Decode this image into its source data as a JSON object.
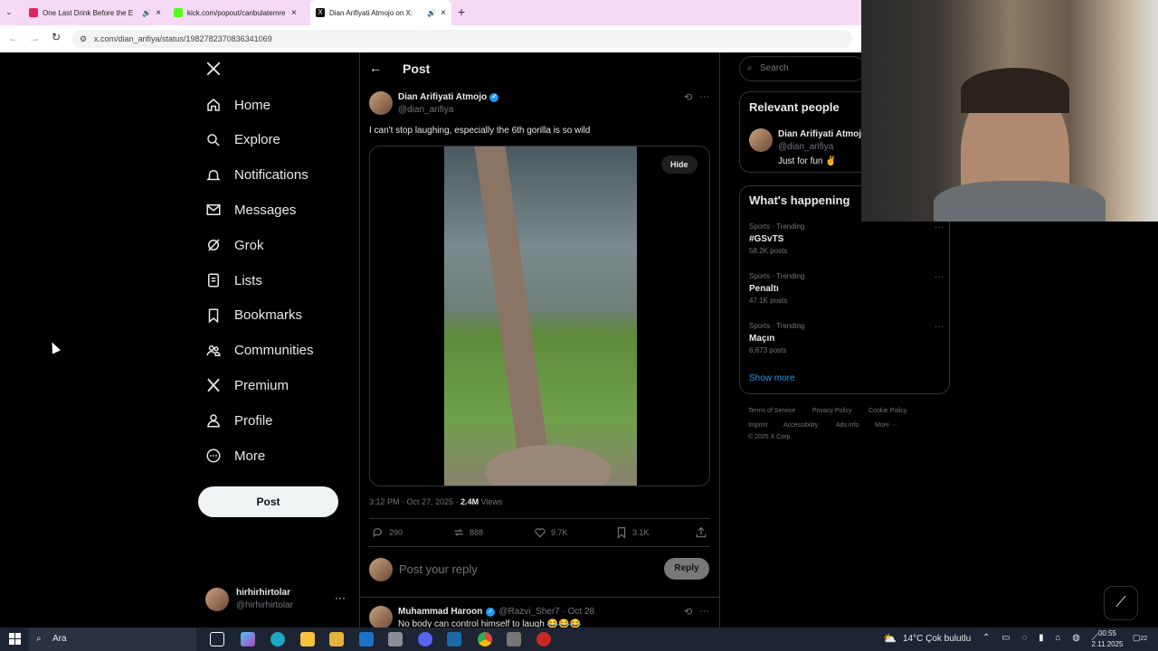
{
  "browser": {
    "tabs": [
      {
        "title": "One Last Drink Before the E",
        "color": "#e0245e"
      },
      {
        "title": "kick.com/popout/canbulatemre",
        "color": "#53fc18"
      },
      {
        "title": "Dian Arifiyati Atmojo on X:",
        "color": "#000000"
      }
    ],
    "url": "x.com/dian_arifiya/status/1982782370836341069"
  },
  "nav": {
    "items": [
      {
        "label": "Home",
        "icon": "home-icon"
      },
      {
        "label": "Explore",
        "icon": "search-icon"
      },
      {
        "label": "Notifications",
        "icon": "bell-icon"
      },
      {
        "label": "Messages",
        "icon": "mail-icon"
      },
      {
        "label": "Grok",
        "icon": "grok-icon"
      },
      {
        "label": "Lists",
        "icon": "list-icon"
      },
      {
        "label": "Bookmarks",
        "icon": "bookmark-icon"
      },
      {
        "label": "Communities",
        "icon": "communities-icon"
      },
      {
        "label": "Premium",
        "icon": "x-logo-icon"
      },
      {
        "label": "Profile",
        "icon": "person-icon"
      },
      {
        "label": "More",
        "icon": "more-circle-icon"
      }
    ],
    "post_button": "Post",
    "account": {
      "name": "hirhirhirtolar",
      "handle": "@hirhirhirtolar"
    }
  },
  "post": {
    "header": "Post",
    "author_name": "Dian Arifiyati Atmojo",
    "author_handle": "@dian_arifiya",
    "text": "I can't stop laughing, especially the 6th gorilla is so wild",
    "hide_label": "Hide",
    "time": "3:12 PM · Oct 27, 2025 · ",
    "views_count": "2.4M",
    "views_label": "Views",
    "stats": {
      "replies": "290",
      "reposts": "888",
      "likes": "9.7K",
      "bookmarks": "3.1K"
    },
    "reply_placeholder": "Post your reply",
    "reply_button": "Reply"
  },
  "reply": {
    "name": "Muhammad Haroon",
    "handle": "@Razvi_Sher7 · Oct 28",
    "text": "No body can control himself to laugh 😂😂😂"
  },
  "sidebar": {
    "search_placeholder": "Search",
    "relevant_title": "Relevant people",
    "relevant_name": "Dian Arifiyati Atmoj",
    "relevant_handle": "@dian_arifiya",
    "relevant_bio": "Just for fun ✌️",
    "happening_title": "What's happening",
    "trends": [
      {
        "category": "Sports · Trending",
        "name": "#GSvTS",
        "posts": "58.2K posts"
      },
      {
        "category": "Sports · Trending",
        "name": "Penaltı",
        "posts": "47.1K posts"
      },
      {
        "category": "Sports · Trending",
        "name": "Maçın",
        "posts": "6,673 posts"
      }
    ],
    "show_more": "Show more",
    "footer": [
      "Terms of Service",
      "Privacy Policy",
      "Cookie Policy",
      "Imprint",
      "Accessibility",
      "Ads info",
      "More ···",
      "© 2025 X Corp."
    ]
  },
  "taskbar": {
    "search": "Ara",
    "weather": "14°C  Çok bulutlu",
    "time": "00:55",
    "date": "2.11.2025",
    "notif_count": "22"
  },
  "colors": {
    "accent": "#1d9bf0",
    "tabbar": "#f6d9f4",
    "taskbar": "#1d2433"
  }
}
